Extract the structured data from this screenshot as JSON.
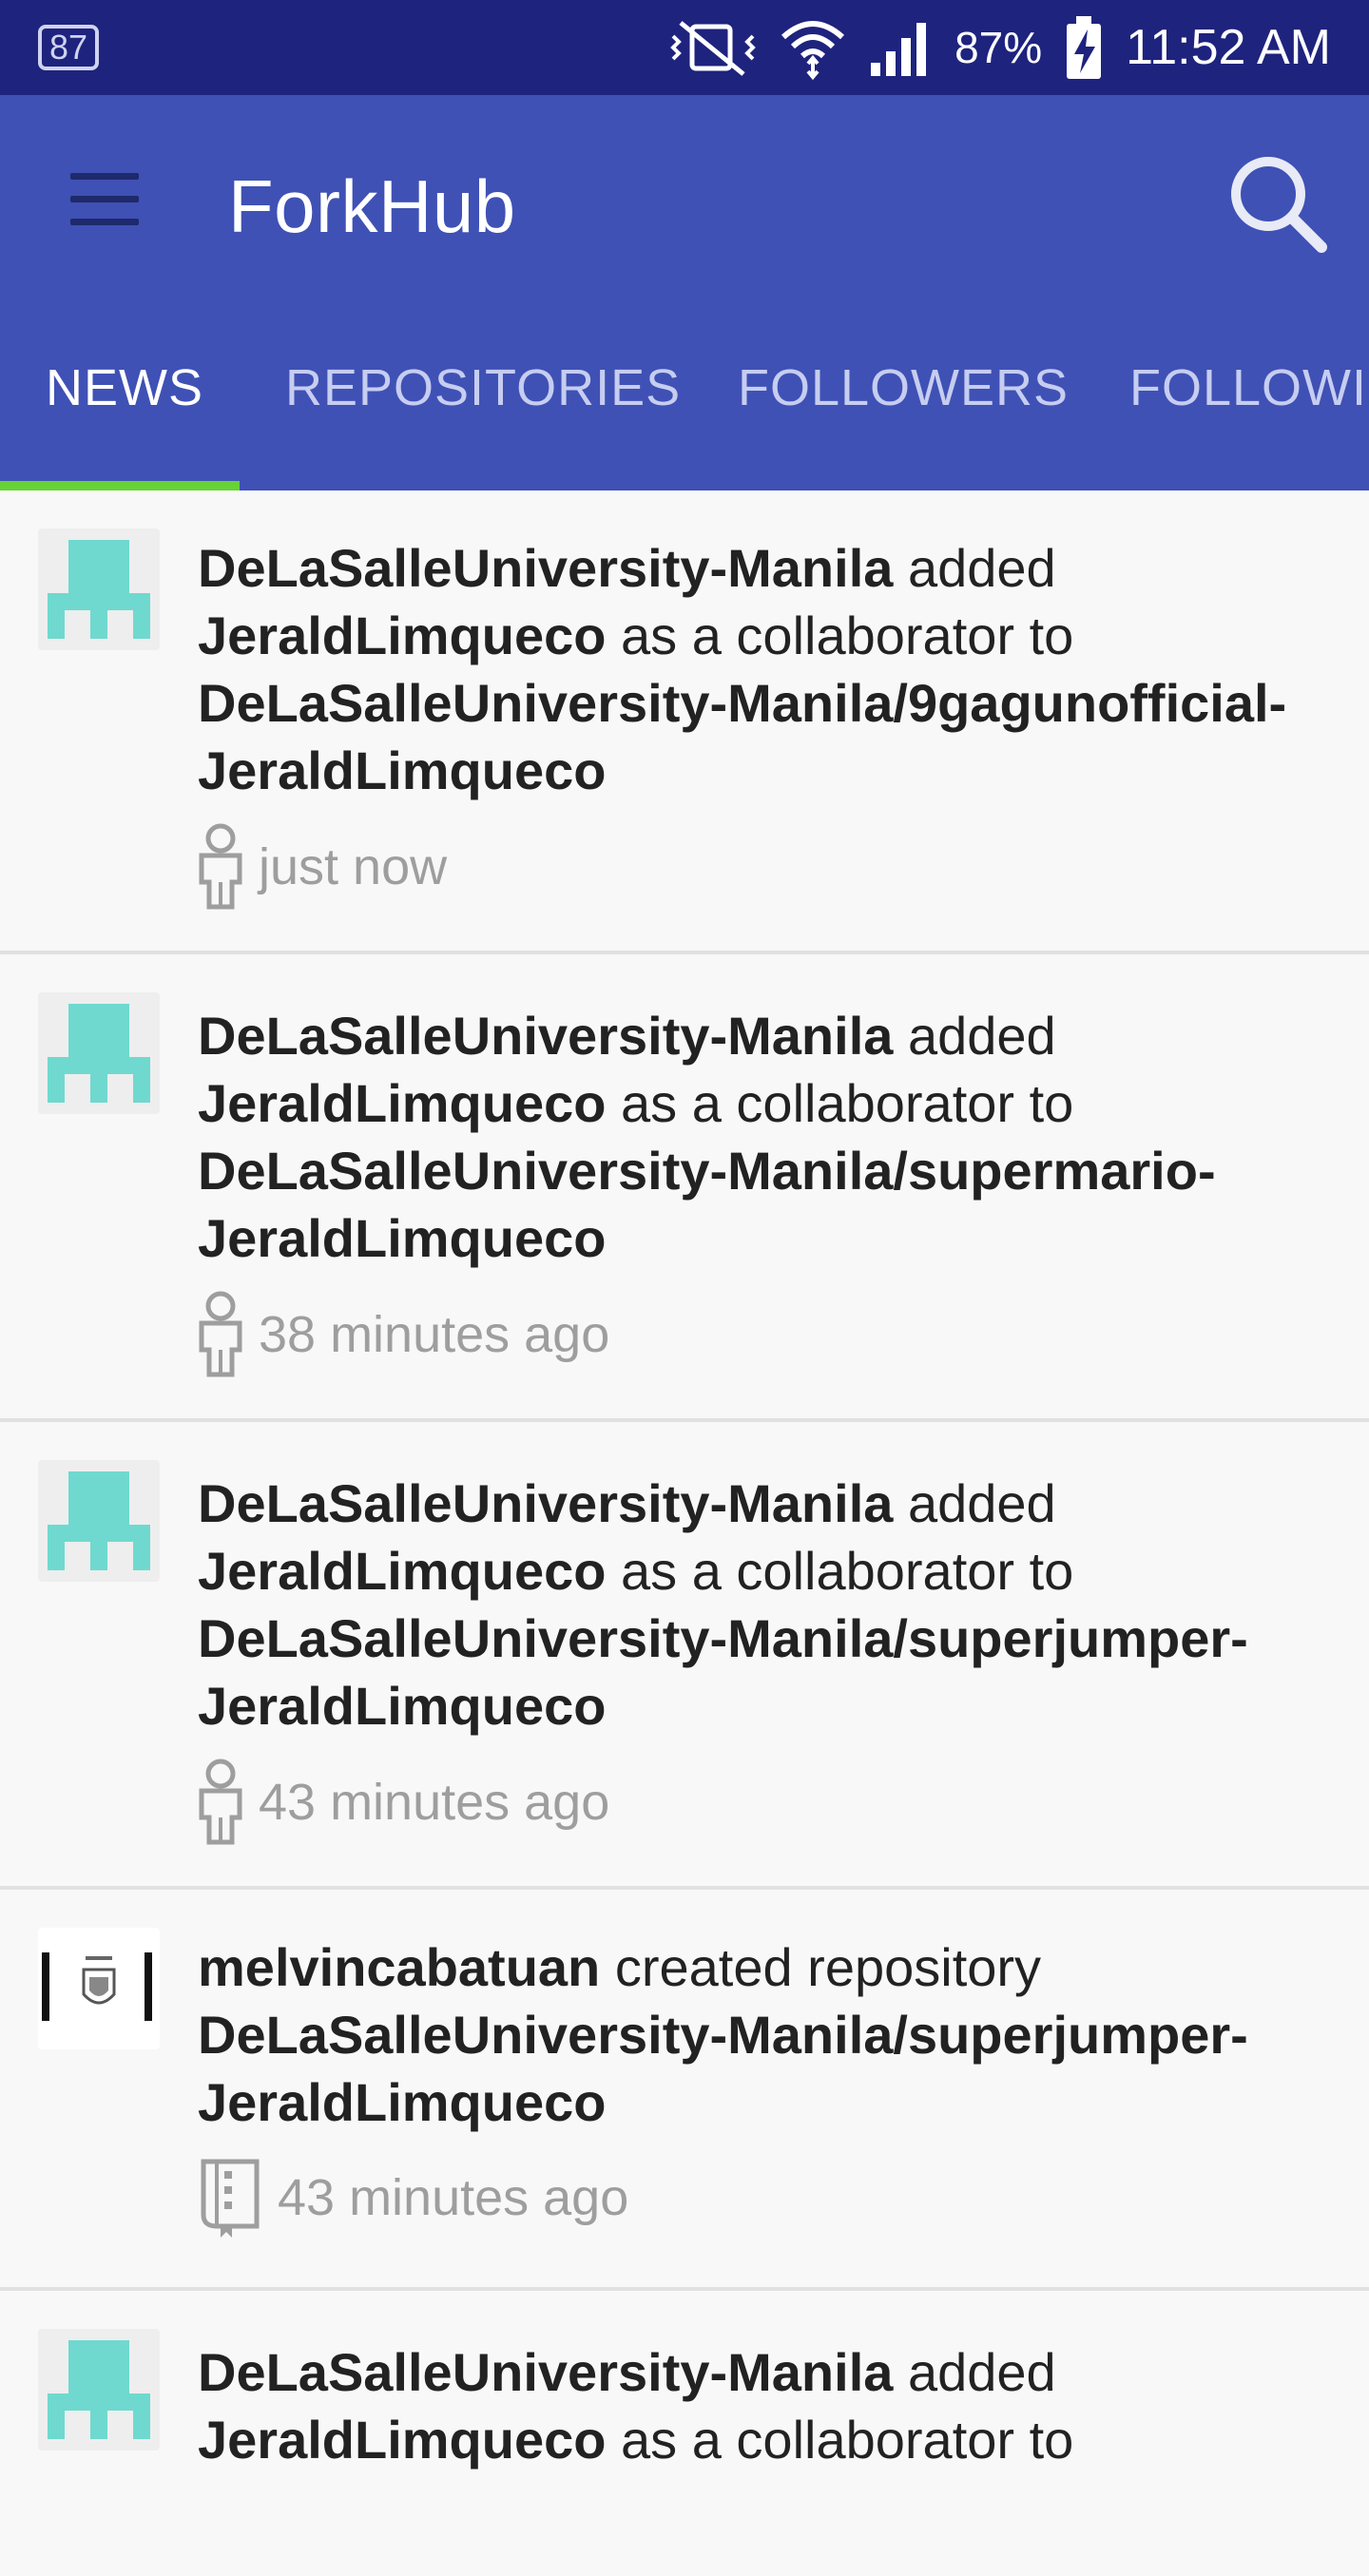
{
  "status_bar": {
    "notification_badge": "87",
    "battery_percent": "87%",
    "time": "11:52 AM",
    "icons": [
      "mute-vibrate-icon",
      "wifi-icon",
      "signal-icon",
      "battery-charging-icon"
    ]
  },
  "app_bar": {
    "title": "ForkHub",
    "menu_icon": "hamburger-menu-icon",
    "search_icon": "search-icon",
    "color": "#3f51b5",
    "status_color": "#1e237e"
  },
  "tabs": [
    {
      "label": "NEWS",
      "active": true
    },
    {
      "label": "REPOSITORIES",
      "active": false
    },
    {
      "label": "FOLLOWERS",
      "active": false
    },
    {
      "label": "FOLLOWING",
      "active": false
    }
  ],
  "tab_indicator_color": "#67d236",
  "feed": [
    {
      "actor": "DeLaSalleUniversity-Manila",
      "action": " added ",
      "target": "JeraldLimqueco",
      "mid": " as a collaborator to ",
      "repo_line1": "DeLaSalleUniversity-Manila/9gagunofficial-",
      "repo_line2": "JeraldLimqueco",
      "time": "just now",
      "icon": "person-icon",
      "avatar": "identicon-avatar"
    },
    {
      "actor": "DeLaSalleUniversity-Manila",
      "action": " added ",
      "target": "JeraldLimqueco",
      "mid": " as a collaborator to ",
      "repo_line1": "DeLaSalleUniversity-Manila/supermario-",
      "repo_line2": "JeraldLimqueco",
      "time": "38 minutes ago",
      "icon": "person-icon",
      "avatar": "identicon-avatar"
    },
    {
      "actor": "DeLaSalleUniversity-Manila",
      "action": " added ",
      "target": "JeraldLimqueco",
      "mid": " as a collaborator to ",
      "repo_line1": "DeLaSalleUniversity-Manila/superjumper-",
      "repo_line2": "JeraldLimqueco",
      "time": "43 minutes ago",
      "icon": "person-icon",
      "avatar": "identicon-avatar"
    },
    {
      "actor": "melvincabatuan",
      "action": " created repository",
      "repo_line1": "DeLaSalleUniversity-Manila/superjumper-",
      "repo_line2": "JeraldLimqueco",
      "time": "43 minutes ago",
      "icon": "repo-book-icon",
      "avatar": "logo-avatar"
    },
    {
      "actor": "DeLaSalleUniversity-Manila",
      "action": " added ",
      "target": "JeraldLimqueco",
      "mid": " as a collaborator to",
      "avatar": "identicon-avatar"
    }
  ],
  "identicon_color": "#6fd9cf"
}
